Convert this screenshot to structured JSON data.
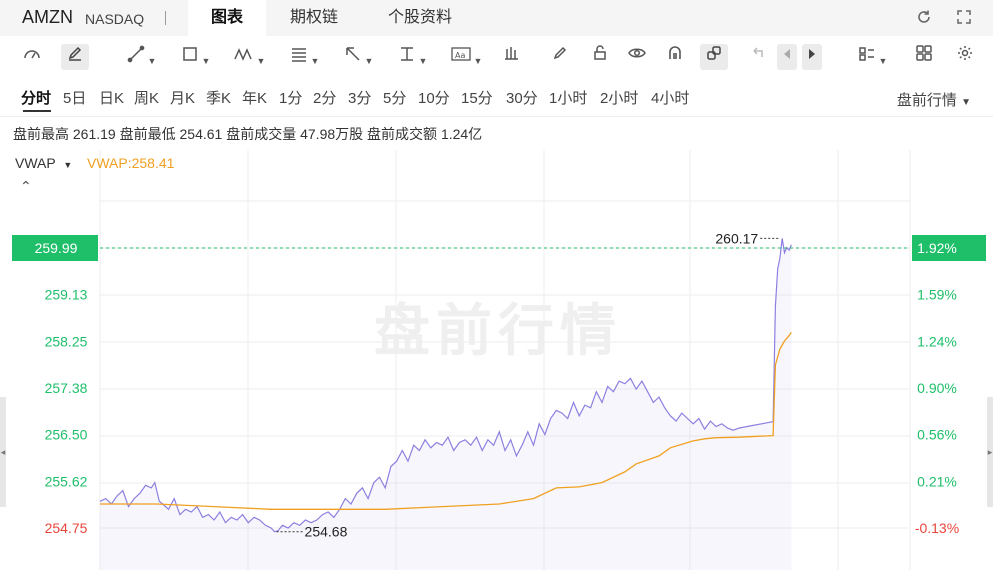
{
  "header": {
    "ticker": "AMZN",
    "exchange": "NASDAQ",
    "tabs": [
      {
        "label": "图表",
        "active": true
      },
      {
        "label": "期权链",
        "active": false
      },
      {
        "label": "个股资料",
        "active": false
      }
    ],
    "icons": [
      "refresh-icon",
      "fullscreen-icon"
    ]
  },
  "toolbar": {
    "tools": [
      "gauge-icon",
      "pencil-icon",
      "line-tool-icon",
      "rect-tool-icon",
      "wave-tool-icon",
      "fib-tool-icon",
      "arrow-tool-icon",
      "measure-tool-icon",
      "text-tool-icon",
      "chart-type-icon",
      "brush-icon",
      "lock-icon",
      "eye-icon",
      "magnet-icon",
      "link-icon",
      "undo-icon",
      "prev-icon",
      "play-icon",
      "layout-icon",
      "grid-icon",
      "settings-icon"
    ]
  },
  "periods": {
    "items": [
      "分时",
      "5日",
      "日K",
      "周K",
      "月K",
      "季K",
      "年K",
      "1分",
      "2分",
      "3分",
      "5分",
      "10分",
      "15分",
      "30分",
      "1小时",
      "2小时",
      "4小时"
    ],
    "active": "分时",
    "session_label": "盘前行情"
  },
  "stats": {
    "high_label": "盘前最高",
    "high": "261.19",
    "low_label": "盘前最低",
    "low": "254.61",
    "vol_label": "盘前成交量",
    "vol": "47.98万股",
    "amt_label": "盘前成交额",
    "amt": "1.24亿"
  },
  "indicator": {
    "name": "VWAP",
    "value_text": "VWAP:258.41"
  },
  "colors": {
    "price_line": "#8b80e0",
    "price_fill": "#8b80e0",
    "vwap_line": "#f0a020",
    "up": "#1fbf6a",
    "down": "#e8453c",
    "grid": "#eeeeee",
    "current_tag": "#1fbf6a"
  },
  "chart_data": {
    "type": "line",
    "watermark": "盘前行情",
    "y_ticks": [
      "259.99",
      "259.13",
      "258.25",
      "257.38",
      "256.50",
      "255.62",
      "254.75"
    ],
    "pct_ticks": [
      "1.92%",
      "1.59%",
      "1.24%",
      "0.90%",
      "0.56%",
      "0.21%",
      "-0.13%"
    ],
    "current_price": "259.99",
    "current_pct": "1.92%",
    "max_label": "260.17",
    "min_label": "254.68",
    "ylim": [
      254.75,
      259.99
    ],
    "series": [
      {
        "name": "price",
        "x": [
          0,
          5,
          10,
          15,
          20,
          25,
          30,
          35,
          40,
          45,
          48,
          52,
          55,
          60,
          65,
          70,
          75,
          80,
          85,
          90,
          95,
          100,
          105,
          110,
          115,
          120,
          125,
          130,
          135,
          140,
          145,
          150,
          153,
          156,
          160,
          165,
          170,
          175,
          180,
          185,
          190,
          195,
          200,
          205,
          210,
          215,
          220,
          225,
          230,
          235,
          240,
          245,
          250,
          255,
          260,
          265,
          270,
          275,
          280,
          285,
          290,
          295,
          300,
          305,
          310,
          315,
          320,
          325,
          330,
          335,
          340,
          345,
          350,
          355,
          360,
          365,
          370,
          375,
          380,
          385,
          390,
          395,
          400,
          405,
          410,
          415,
          420,
          425,
          430,
          435,
          440,
          445,
          450,
          455,
          460,
          465,
          470,
          475,
          480,
          485,
          490,
          495,
          500,
          505,
          510,
          515,
          520,
          525,
          530,
          535,
          540,
          545,
          550,
          555,
          560,
          565,
          570,
          575,
          580,
          585,
          590,
          592,
          594,
          596,
          598,
          600,
          602,
          604,
          606
        ],
        "values": [
          255.25,
          255.3,
          255.2,
          255.35,
          255.45,
          255.15,
          255.3,
          255.4,
          255.55,
          255.5,
          255.6,
          255.25,
          255.2,
          255.1,
          255.3,
          255.0,
          255.1,
          255.05,
          255.15,
          254.95,
          255.0,
          254.9,
          255.05,
          254.85,
          254.95,
          254.9,
          255.0,
          254.85,
          254.95,
          254.9,
          254.8,
          254.75,
          254.68,
          254.7,
          254.8,
          254.75,
          254.85,
          254.8,
          254.9,
          254.85,
          254.9,
          255.0,
          255.05,
          254.95,
          255.1,
          255.3,
          255.2,
          255.4,
          255.5,
          255.3,
          255.6,
          255.7,
          255.5,
          255.9,
          256.0,
          256.2,
          256.0,
          256.3,
          256.2,
          256.4,
          256.25,
          256.35,
          256.3,
          256.45,
          256.2,
          256.35,
          256.4,
          256.3,
          256.45,
          256.2,
          256.4,
          256.3,
          256.55,
          256.2,
          256.4,
          256.1,
          256.3,
          256.55,
          256.3,
          256.7,
          256.5,
          256.8,
          256.95,
          256.9,
          256.8,
          257.1,
          256.85,
          257.05,
          257.0,
          257.3,
          257.1,
          257.4,
          257.3,
          257.5,
          257.45,
          257.55,
          257.35,
          257.5,
          257.3,
          257.1,
          257.2,
          257.0,
          256.85,
          256.75,
          256.9,
          256.8,
          256.7,
          256.8,
          256.6,
          256.75,
          256.65,
          256.7,
          256.62,
          256.58,
          256.62,
          256.64,
          256.66,
          256.68,
          256.7,
          256.72,
          256.74,
          258.9,
          259.6,
          259.8,
          260.17,
          259.9,
          260.0,
          259.95,
          260.05
        ]
      },
      {
        "name": "vwap",
        "x": [
          0,
          50,
          100,
          150,
          200,
          250,
          300,
          350,
          380,
          400,
          420,
          440,
          460,
          470,
          490,
          500,
          520,
          530,
          540,
          560,
          590,
          592,
          596,
          600,
          604,
          606
        ],
        "values": [
          255.2,
          255.2,
          255.15,
          255.1,
          255.1,
          255.1,
          255.15,
          255.2,
          255.3,
          255.5,
          255.52,
          255.6,
          255.8,
          255.95,
          256.1,
          256.25,
          256.38,
          256.42,
          256.44,
          256.45,
          256.48,
          257.8,
          258.1,
          258.25,
          258.35,
          258.41
        ]
      }
    ],
    "xlim": [
      0,
      606
    ],
    "grid": true,
    "legend": "none"
  }
}
